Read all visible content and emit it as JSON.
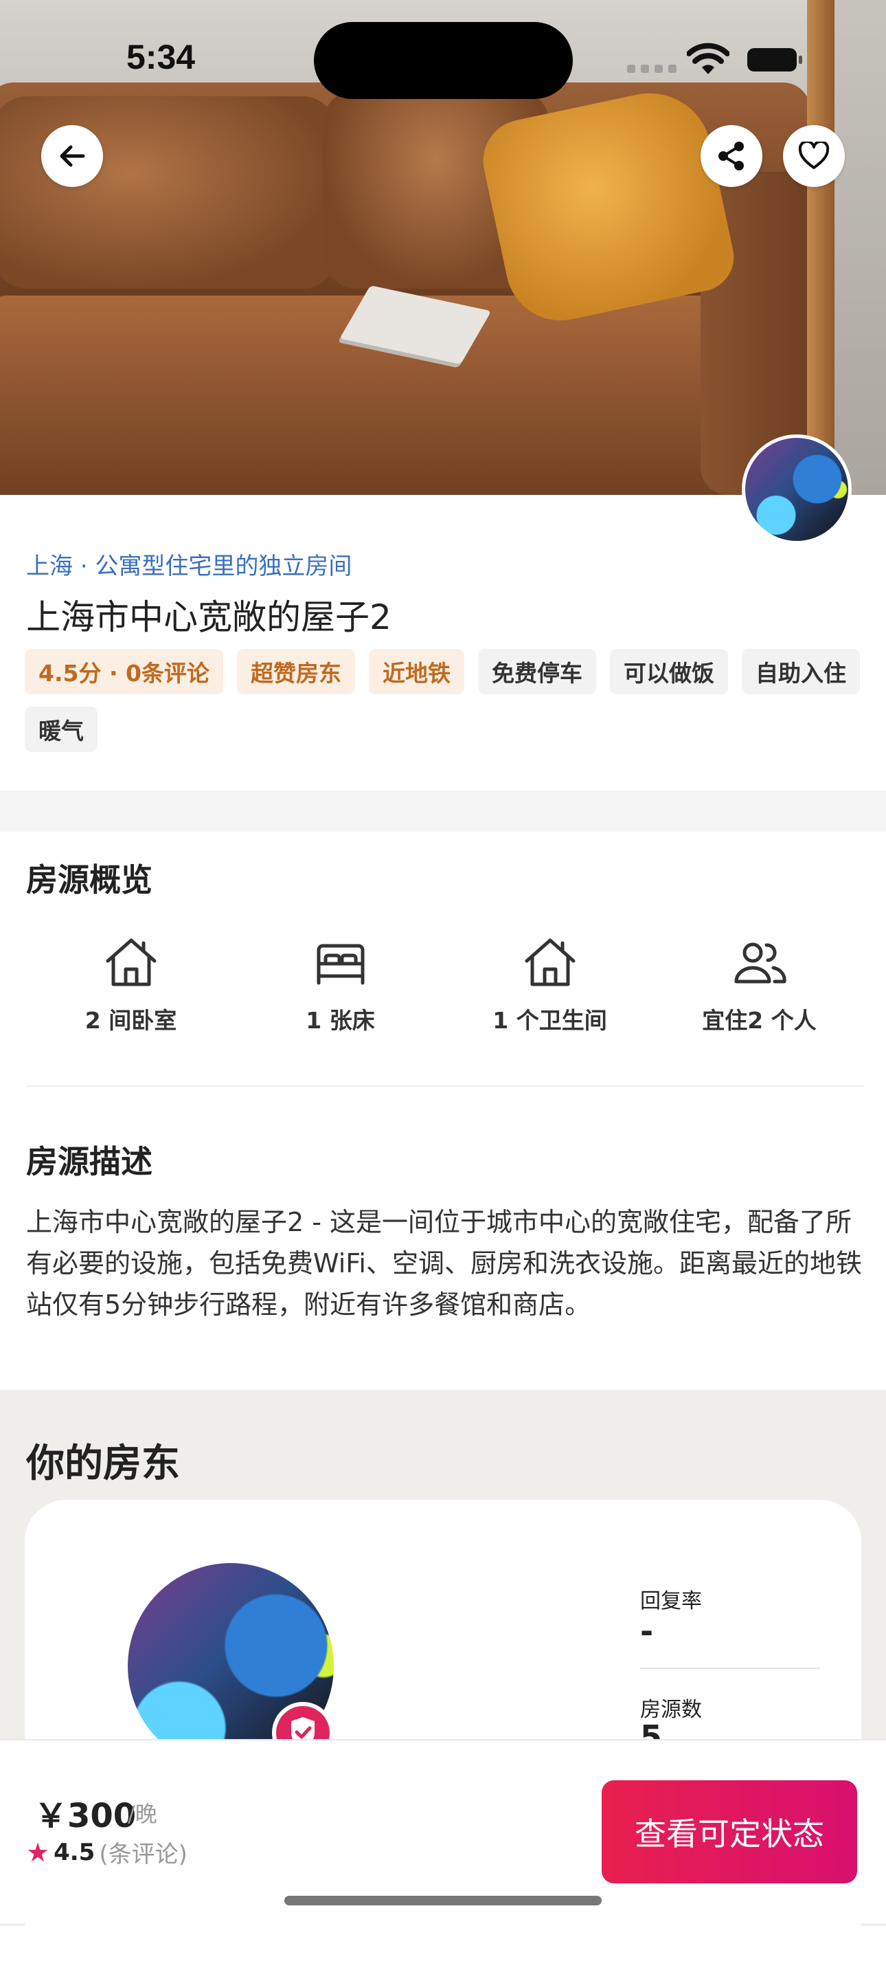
{
  "status_bar": {
    "time": "5:34"
  },
  "hero": {
    "back_icon": "arrow-left-icon",
    "share_icon": "share-icon",
    "favorite_icon": "heart-icon"
  },
  "listing": {
    "subtitle": "上海 · 公寓型住宅里的独立房间",
    "title": "上海市中心宽敞的屋子2",
    "tags": [
      {
        "label": "4.5分 · 0条评论",
        "highlight": true
      },
      {
        "label": "超赞房东",
        "highlight": true
      },
      {
        "label": "近地铁",
        "highlight": true
      },
      {
        "label": "免费停车",
        "highlight": false
      },
      {
        "label": "可以做饭",
        "highlight": false
      },
      {
        "label": "自助入住",
        "highlight": false
      },
      {
        "label": "暖气",
        "highlight": false
      }
    ]
  },
  "overview": {
    "title": "房源概览",
    "items": [
      {
        "icon": "house-icon",
        "label": "2 间卧室"
      },
      {
        "icon": "bed-icon",
        "label": "1 张床"
      },
      {
        "icon": "house-icon",
        "label": "1 个卫生间"
      },
      {
        "icon": "people-icon",
        "label": "宜住2 个人"
      }
    ]
  },
  "description": {
    "title": "房源描述",
    "text": "上海市中心宽敞的屋子2 - 这是一间位于城市中心的宽敞住宅，配备了所有必要的设施，包括免费WiFi、空调、厨房和洗衣设施。距离最近的地铁站仅有5分钟步行路程，附近有许多餐馆和商店。"
  },
  "host": {
    "title": "你的房东",
    "stats": [
      {
        "label": "回复率",
        "value": "-"
      },
      {
        "label": "房源数",
        "value": "5"
      }
    ]
  },
  "booking": {
    "price": "￥300",
    "price_unit": "/晚",
    "rating_star": "★",
    "rating": "4.5",
    "review_count": "(条评论)",
    "cta_label": "查看可定状态"
  },
  "colors": {
    "accent": "#e0245e",
    "link": "#3a6fc2",
    "tag_highlight_bg": "#fbeee3",
    "tag_highlight_text": "#c06a1f"
  }
}
